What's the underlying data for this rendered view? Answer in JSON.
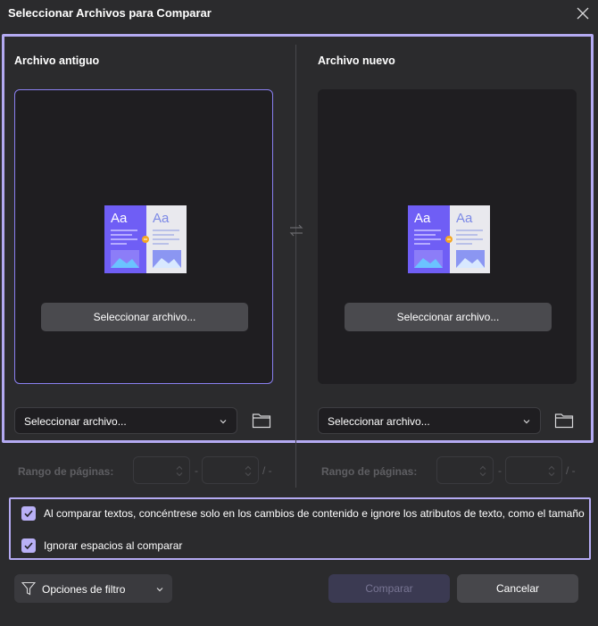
{
  "window": {
    "title": "Seleccionar Archivos para Comparar"
  },
  "panels": {
    "old": {
      "title": "Archivo antiguo",
      "select_button": "Seleccionar archivo...",
      "dropdown_value": "Seleccionar archivo...",
      "page_range_label": "Rango de páginas:",
      "range_dash": "-",
      "range_total": "/ -"
    },
    "new": {
      "title": "Archivo nuevo",
      "select_button": "Seleccionar archivo...",
      "dropdown_value": "Seleccionar archivo...",
      "page_range_label": "Rango de páginas:",
      "range_dash": "-",
      "range_total": "/ -"
    }
  },
  "options": {
    "content_only": {
      "label": "Al comparar textos, concéntrese solo en los cambios de contenido e ignore los atributos de texto, como el tamaño",
      "checked": true
    },
    "ignore_spaces": {
      "label": "Ignorar espacios al comparar",
      "checked": true
    }
  },
  "footer": {
    "filter_label": "Opciones de filtro",
    "compare_label": "Comparar",
    "cancel_label": "Cancelar"
  },
  "icons": {
    "close": "close-icon",
    "swap": "swap-arrows-icon",
    "document": "document-compare-icon",
    "folder": "folder-icon",
    "chevron": "chevron-down-icon",
    "filter": "filter-icon",
    "check": "check-icon"
  },
  "colors": {
    "background": "#2b2b2d",
    "accent": "#b4aaf2",
    "drop_zone": "#1f1e21",
    "checkbox": "#b9b0f6"
  }
}
